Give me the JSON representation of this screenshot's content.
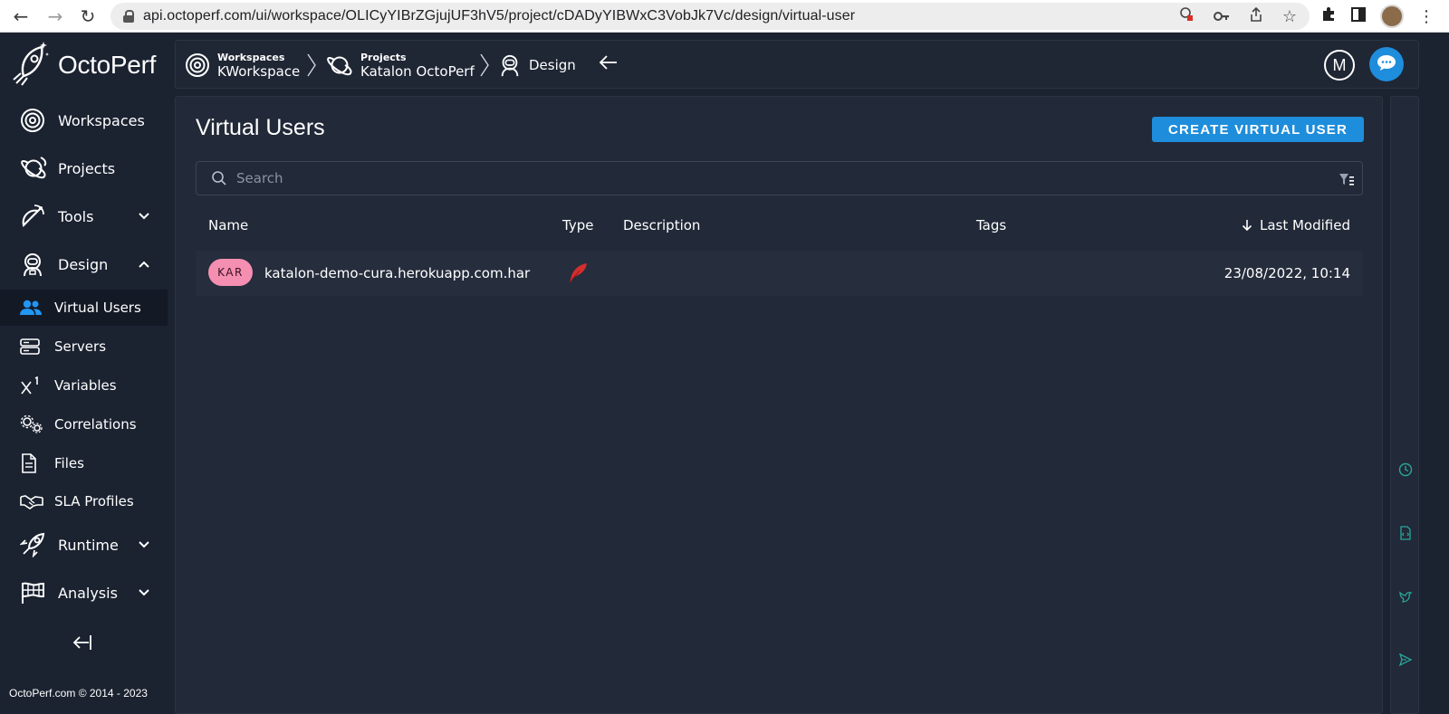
{
  "browser": {
    "url": "api.octoperf.com/ui/workspace/OLICyYIBrZGjujUF3hV5/project/cDADyYIBWxC3VobJk7Vc/design/virtual-user"
  },
  "brand": {
    "name": "OctoPerf",
    "accent": "#1e8ddb",
    "sidebar_bg": "#1b2230",
    "panel_bg": "#222938"
  },
  "sidebar": {
    "items": [
      {
        "label": "Workspaces",
        "icon": "workspace-icon"
      },
      {
        "label": "Projects",
        "icon": "planet-icon"
      },
      {
        "label": "Tools",
        "icon": "satellite-icon"
      },
      {
        "label": "Design",
        "icon": "astronaut-icon"
      },
      {
        "label": "Virtual Users",
        "icon": "users-icon"
      },
      {
        "label": "Servers",
        "icon": "server-icon"
      },
      {
        "label": "Variables",
        "icon": "variable-icon"
      },
      {
        "label": "Correlations",
        "icon": "gears-icon"
      },
      {
        "label": "Files",
        "icon": "file-icon"
      },
      {
        "label": "SLA Profiles",
        "icon": "handshake-icon"
      },
      {
        "label": "Runtime",
        "icon": "rocket-icon"
      },
      {
        "label": "Analysis",
        "icon": "flag-icon"
      }
    ],
    "copyright": "OctoPerf.com © 2014 - 2023"
  },
  "header": {
    "breadcrumbs": [
      {
        "small": "Workspaces",
        "big": "KWorkspace"
      },
      {
        "small": "Projects",
        "big": "Katalon OctoPerf"
      },
      {
        "big": "Design"
      }
    ],
    "avatar_letter": "M"
  },
  "main": {
    "title": "Virtual Users",
    "create_label": "CREATE VIRTUAL USER",
    "search_placeholder": "Search",
    "columns": {
      "name": "Name",
      "type": "Type",
      "description": "Description",
      "tags": "Tags",
      "last_modified": "Last Modified"
    },
    "rows": [
      {
        "tag": "KAR",
        "tag_color": "#f48fb1",
        "name": "katalon-demo-cura.herokuapp.com.har",
        "type_icon": "feather-icon",
        "type_color": "#d32f2f",
        "description": "",
        "tags": "",
        "last_modified": "23/08/2022, 10:14"
      }
    ]
  }
}
